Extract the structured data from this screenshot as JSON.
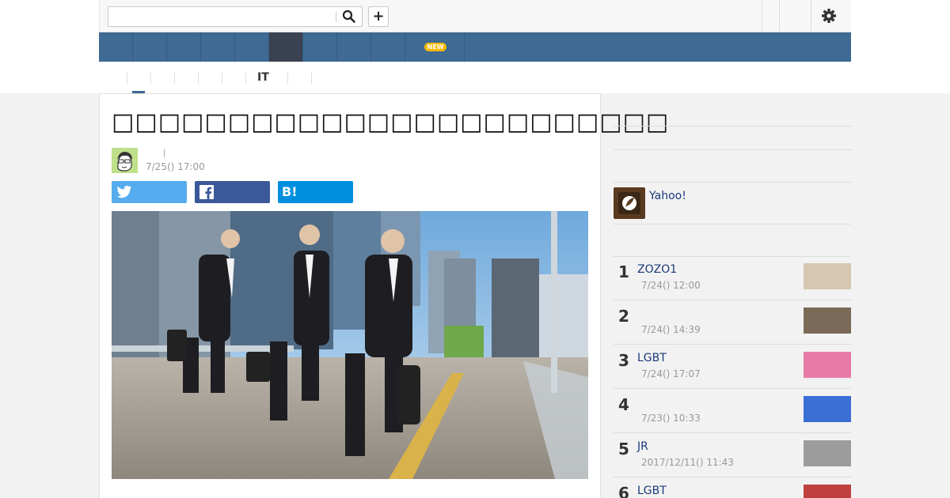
{
  "search": {
    "placeholder": ""
  },
  "header": {
    "add_label": "+"
  },
  "nav": {
    "badge": "NEW"
  },
  "subnav": {
    "active_text": "IT"
  },
  "article": {
    "title": "□□□□□□□□□□□□□□□□□□□□□□□□",
    "date": "7/25() 17:00"
  },
  "share": {
    "hatena_label": "B!"
  },
  "sidebar": {
    "yahoo_label": "Yahoo!",
    "ranking": [
      {
        "rank": "1",
        "title": "ZOZO1",
        "date": "7/24() 12:00",
        "thumb": "#d7c6b0"
      },
      {
        "rank": "2",
        "title": "",
        "date": "7/24() 14:39",
        "thumb": "#7c6a58"
      },
      {
        "rank": "3",
        "title": "LGBT",
        "date": "7/24() 17:07",
        "thumb": "#e87aa8"
      },
      {
        "rank": "4",
        "title": "",
        "date": "7/23() 10:33",
        "thumb": "#3b6fd6"
      },
      {
        "rank": "5",
        "title": "JR",
        "date": "2017/12/11() 11:43",
        "thumb": "#9c9c9c"
      },
      {
        "rank": "6",
        "title": "LGBT",
        "date": "",
        "thumb": "#c04040"
      }
    ]
  }
}
